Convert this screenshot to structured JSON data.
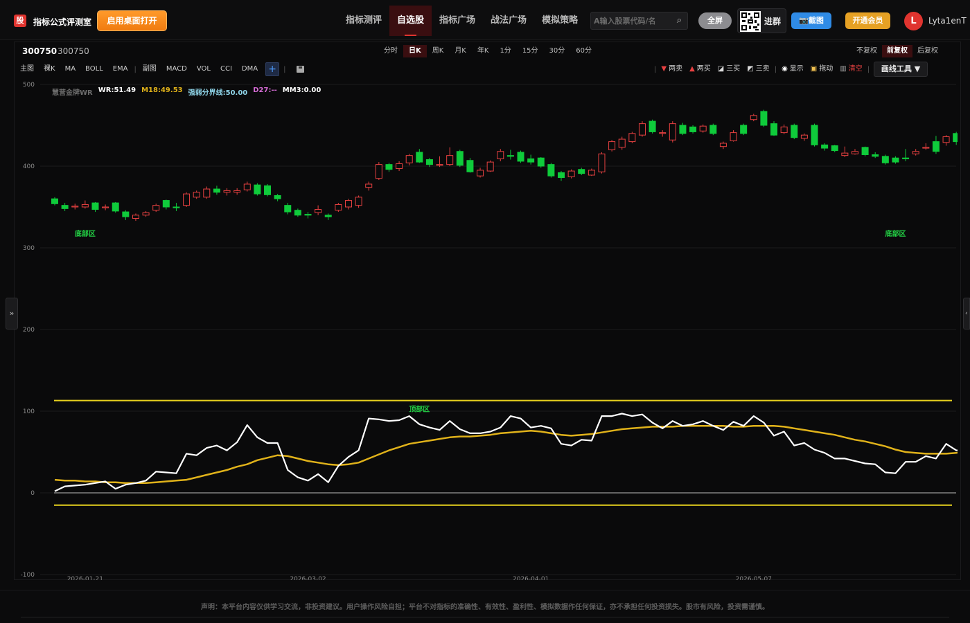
{
  "header": {
    "logo_glyph": "股",
    "app_title": "指标公式评测室",
    "desktop_button": "启用桌面打开",
    "nav": [
      {
        "label": "指标测评",
        "active": false
      },
      {
        "label": "自选股",
        "active": true
      },
      {
        "label": "指标广场",
        "active": false
      },
      {
        "label": "战法广场",
        "active": false
      },
      {
        "label": "模拟策略",
        "active": false
      }
    ],
    "search_placeholder": "A输入股票代码/名",
    "search_icon": "search-icon",
    "fullscreen_label": "全屏",
    "qr_label": "进群",
    "screenshot_label": "📷截图",
    "vip_label": "开通会员",
    "avatar_letter": "L",
    "username": "Lyta1enT"
  },
  "stock": {
    "code": "300750",
    "name": "300750"
  },
  "periods": [
    {
      "label": "分时",
      "active": false
    },
    {
      "label": "日K",
      "active": true
    },
    {
      "label": "周K",
      "active": false
    },
    {
      "label": "月K",
      "active": false
    },
    {
      "label": "年K",
      "active": false
    },
    {
      "label": "1分",
      "active": false
    },
    {
      "label": "15分",
      "active": false
    },
    {
      "label": "30分",
      "active": false
    },
    {
      "label": "60分",
      "active": false
    }
  ],
  "adjust": [
    {
      "label": "不复权",
      "active": false
    },
    {
      "label": "前复权",
      "active": true
    },
    {
      "label": "后复权",
      "active": false
    }
  ],
  "toolbar_left": [
    "主图",
    "裸K",
    "MA",
    "BOLL",
    "EMA"
  ],
  "toolbar_sub": [
    "副图",
    "MACD",
    "VOL",
    "CCI",
    "DMA"
  ],
  "toolbar_plus": "+",
  "drawbar": {
    "sell2": "两卖",
    "buy2": "两买",
    "buy3": "三买",
    "sell3": "三卖",
    "show": "显示",
    "drag": "拖动",
    "clear": "清空",
    "tools": "画线工具 ▼"
  },
  "legend": [
    {
      "text": "慧营金牌WR",
      "color": "#6b6b6b"
    },
    {
      "text": "WR:51.49",
      "color": "#ffffff"
    },
    {
      "text": "M18:49.53",
      "color": "#e0b21a"
    },
    {
      "text": "强弱分界线:50.00",
      "color": "#8fd4e8"
    },
    {
      "text": "D27:--",
      "color": "#d46bd4"
    },
    {
      "text": "MM3:0.00",
      "color": "#ffffff"
    }
  ],
  "footer": "声明：本平台内容仅供学习交流，非投资建议。用户操作风险自担；平台不对指标的准确性、有效性、盈利性、模拟数据作任何保证，亦不承担任何投资损失。股市有风险，投资需谨慎。",
  "chart_data": {
    "type": "candlestick",
    "ylim": [
      -100,
      500
    ],
    "y_ticks": [
      500,
      400,
      300,
      200,
      100,
      0,
      -100
    ],
    "x_tick_labels": [
      "2026-01-21",
      "2026-03-02",
      "2026-04-01",
      "2026-05-07"
    ],
    "x_tick_index": [
      3,
      25,
      47,
      69
    ],
    "colors": {
      "up": "#e84141",
      "down": "#0fcb3b",
      "wr": "#ffffff",
      "m18": "#e0b21a",
      "band": "#e8d21e",
      "zero": "#9a9a9a"
    },
    "bands": [
      113,
      -15
    ],
    "zone_labels": [
      {
        "text": "底部区",
        "x_index": 3,
        "y": 318
      },
      {
        "text": "底部区",
        "x_index": 83,
        "y": 318
      },
      {
        "text": "顶部区",
        "x_index": 36,
        "y": 103
      }
    ],
    "candles": [
      [
        360,
        354,
        362,
        352
      ],
      [
        352,
        348,
        355,
        345
      ],
      [
        350,
        351,
        354,
        347
      ],
      [
        350,
        353,
        358,
        348
      ],
      [
        355,
        347,
        356,
        344
      ],
      [
        349,
        350,
        353,
        346
      ],
      [
        355,
        345,
        356,
        343
      ],
      [
        344,
        338,
        346,
        334
      ],
      [
        336,
        340,
        342,
        333
      ],
      [
        340,
        343,
        345,
        338
      ],
      [
        346,
        352,
        354,
        344
      ],
      [
        358,
        350,
        359,
        347
      ],
      [
        350,
        349,
        355,
        345
      ],
      [
        352,
        366,
        368,
        350
      ],
      [
        362,
        368,
        370,
        360
      ],
      [
        362,
        372,
        375,
        360
      ],
      [
        372,
        368,
        376,
        365
      ],
      [
        368,
        370,
        373,
        364
      ],
      [
        368,
        370,
        373,
        365
      ],
      [
        371,
        378,
        381,
        369
      ],
      [
        377,
        366,
        379,
        364
      ],
      [
        376,
        365,
        378,
        363
      ],
      [
        364,
        360,
        366,
        357
      ],
      [
        352,
        344,
        355,
        341
      ],
      [
        346,
        340,
        348,
        338
      ],
      [
        341,
        340,
        344,
        336
      ],
      [
        343,
        347,
        352,
        340
      ],
      [
        340,
        338,
        342,
        334
      ],
      [
        346,
        353,
        355,
        344
      ],
      [
        350,
        358,
        360,
        347
      ],
      [
        352,
        362,
        364,
        349
      ],
      [
        374,
        378,
        381,
        370
      ],
      [
        385,
        402,
        405,
        383
      ],
      [
        402,
        396,
        404,
        393
      ],
      [
        397,
        403,
        406,
        394
      ],
      [
        404,
        413,
        415,
        401
      ],
      [
        417,
        405,
        421,
        404
      ],
      [
        408,
        402,
        410,
        399
      ],
      [
        401,
        402,
        412,
        399
      ],
      [
        402,
        413,
        423,
        400
      ],
      [
        418,
        401,
        420,
        399
      ],
      [
        407,
        393,
        410,
        392
      ],
      [
        388,
        395,
        398,
        386
      ],
      [
        394,
        405,
        407,
        393
      ],
      [
        409,
        418,
        421,
        406
      ],
      [
        413,
        412,
        420,
        408
      ],
      [
        417,
        406,
        419,
        404
      ],
      [
        409,
        405,
        414,
        402
      ],
      [
        410,
        400,
        411,
        398
      ],
      [
        402,
        388,
        404,
        386
      ],
      [
        392,
        386,
        394,
        382
      ],
      [
        387,
        394,
        396,
        385
      ],
      [
        396,
        391,
        398,
        389
      ],
      [
        389,
        395,
        397,
        388
      ],
      [
        393,
        415,
        417,
        391
      ],
      [
        420,
        430,
        432,
        418
      ],
      [
        423,
        433,
        436,
        420
      ],
      [
        430,
        440,
        442,
        428
      ],
      [
        438,
        452,
        455,
        436
      ],
      [
        455,
        442,
        457,
        440
      ],
      [
        440,
        441,
        444,
        436
      ],
      [
        432,
        452,
        455,
        429
      ],
      [
        450,
        440,
        453,
        438
      ],
      [
        448,
        442,
        450,
        440
      ],
      [
        443,
        449,
        451,
        441
      ],
      [
        450,
        440,
        452,
        438
      ],
      [
        424,
        428,
        430,
        421
      ],
      [
        431,
        441,
        444,
        430
      ],
      [
        450,
        440,
        452,
        438
      ],
      [
        457,
        462,
        464,
        455
      ],
      [
        467,
        450,
        469,
        448
      ],
      [
        452,
        438,
        455,
        437
      ],
      [
        441,
        448,
        451,
        439
      ],
      [
        450,
        435,
        452,
        433
      ],
      [
        434,
        438,
        440,
        431
      ],
      [
        450,
        426,
        452,
        424
      ],
      [
        426,
        422,
        428,
        419
      ],
      [
        425,
        419,
        426,
        417
      ],
      [
        413,
        416,
        424,
        411
      ],
      [
        415,
        418,
        421,
        414
      ],
      [
        423,
        414,
        424,
        412
      ],
      [
        414,
        412,
        417,
        410
      ],
      [
        412,
        404,
        414,
        402
      ],
      [
        410,
        405,
        412,
        403
      ],
      [
        410,
        409,
        421,
        406
      ],
      [
        415,
        418,
        421,
        413
      ],
      [
        422,
        423,
        428,
        420
      ],
      [
        430,
        418,
        437,
        415
      ],
      [
        429,
        436,
        438,
        425
      ],
      [
        440,
        430,
        442,
        426
      ],
      [
        438,
        425,
        440,
        423
      ]
    ],
    "wr": [
      2,
      8,
      9,
      10,
      12,
      14,
      5,
      10,
      12,
      15,
      26,
      25,
      24,
      48,
      46,
      55,
      58,
      52,
      62,
      83,
      68,
      61,
      61,
      28,
      19,
      15,
      23,
      13,
      33,
      44,
      52,
      91,
      90,
      88,
      89,
      94,
      84,
      80,
      77,
      88,
      78,
      73,
      73,
      75,
      80,
      94,
      91,
      80,
      82,
      79,
      60,
      58,
      65,
      64,
      94,
      94,
      97,
      94,
      96,
      86,
      79,
      88,
      82,
      84,
      88,
      82,
      77,
      87,
      82,
      94,
      86,
      70,
      75,
      58,
      61,
      53,
      49,
      42,
      42,
      39,
      36,
      35,
      25,
      24,
      38,
      38,
      45,
      42,
      60,
      52,
      52
    ],
    "m18": [
      16,
      15,
      15,
      14,
      14,
      13,
      13,
      12,
      12,
      12,
      13,
      14,
      15,
      16,
      19,
      22,
      25,
      28,
      32,
      35,
      40,
      43,
      46,
      45,
      42,
      39,
      37,
      35,
      34,
      35,
      37,
      42,
      47,
      52,
      56,
      60,
      62,
      64,
      66,
      68,
      69,
      69,
      70,
      71,
      73,
      74,
      75,
      76,
      75,
      73,
      71,
      70,
      71,
      72,
      74,
      76,
      78,
      79,
      80,
      81,
      81,
      81,
      82,
      82,
      82,
      82,
      82,
      81,
      81,
      82,
      82,
      82,
      81,
      79,
      77,
      75,
      73,
      71,
      68,
      65,
      63,
      60,
      57,
      53,
      50,
      49,
      48,
      48,
      48,
      49,
      50
    ]
  }
}
